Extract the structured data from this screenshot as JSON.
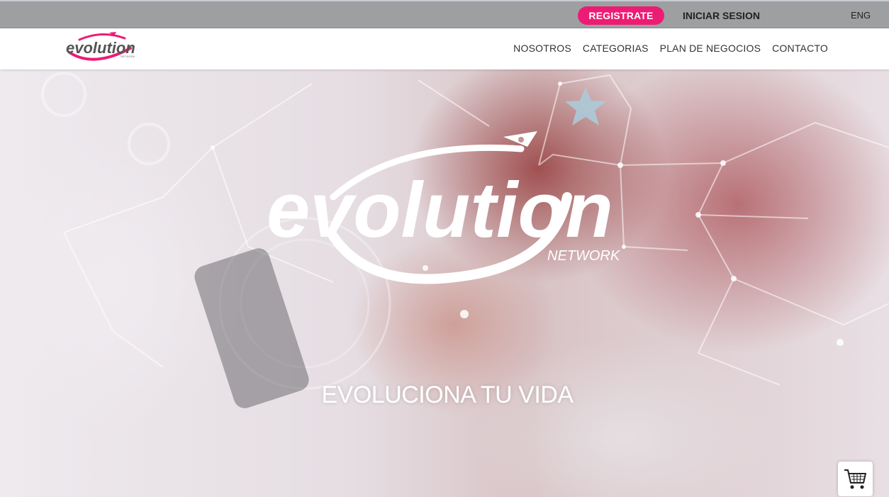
{
  "topbar": {
    "register_label": "REGISTRATE",
    "login_label": "INICIAR SESION",
    "language_label": "ENG"
  },
  "header": {
    "logo_text": "evolution",
    "logo_subtext": "NETWORK",
    "nav": [
      {
        "label": "NOSOTROS"
      },
      {
        "label": "CATEGORIAS"
      },
      {
        "label": "PLAN DE NEGOCIOS"
      },
      {
        "label": "CONTACTO"
      }
    ]
  },
  "hero": {
    "logo_text": "evolution",
    "logo_subtext": "NETWORK",
    "tagline": "EVOLUCIONA TU VIDA"
  },
  "cart": {
    "icon": "shopping-cart-icon"
  },
  "colors": {
    "accent": "#ec1c74",
    "topbar_bg": "#9d9fa1"
  }
}
